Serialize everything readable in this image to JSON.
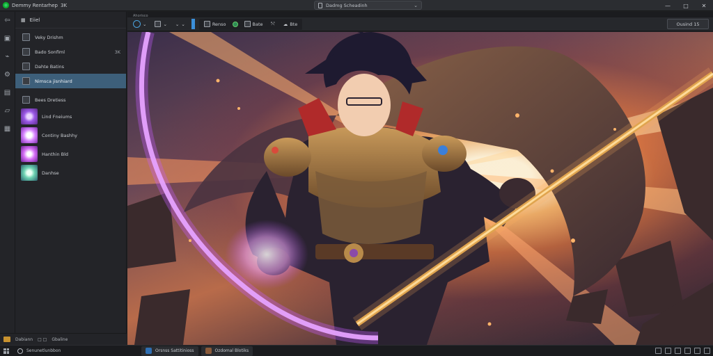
{
  "titlebar": {
    "app_title": "Demmy Rentarhep",
    "title_suffix": "3K",
    "search_text": "Dadmg Scheadinh",
    "minimize": "—",
    "maximize": "□",
    "close": "✕"
  },
  "activity_bar": {
    "icons": [
      "back-arrow-icon",
      "files-icon",
      "link-icon",
      "settings-icon",
      "calendar-icon",
      "folder-icon",
      "grid-icon"
    ]
  },
  "sidebar": {
    "header": "Eiiel",
    "items": [
      {
        "label": "Veky Drishm",
        "kbd": ""
      },
      {
        "label": "Bado Sonfiml",
        "kbd": "3K"
      },
      {
        "label": "Dahte Batins",
        "kbd": ""
      },
      {
        "label": "Nimsca jisnhiard",
        "kbd": ""
      },
      {
        "label": "Bees Dretiess",
        "kbd": ""
      }
    ],
    "thumb_items": [
      {
        "label": "Lind Fneiums"
      },
      {
        "label": "Continy Bashhy"
      },
      {
        "label": "Hanthin Bld"
      },
      {
        "label": "Danhse"
      }
    ],
    "status": {
      "left": "Dabiann",
      "mid": "□ □",
      "right": "Gbaline"
    }
  },
  "editor": {
    "tab_strip_label": "Ahorisco",
    "toolbar": {
      "btn1": "Renso",
      "btn2": "Bate",
      "btn3": "Bte",
      "right_button": "Ousind 15"
    }
  },
  "taskbar": {
    "search_text": "Senunetlunbbon",
    "apps": [
      {
        "label": "Orsnss Sattitinioss"
      },
      {
        "label": "Ozdomal Blotiks"
      }
    ]
  }
}
